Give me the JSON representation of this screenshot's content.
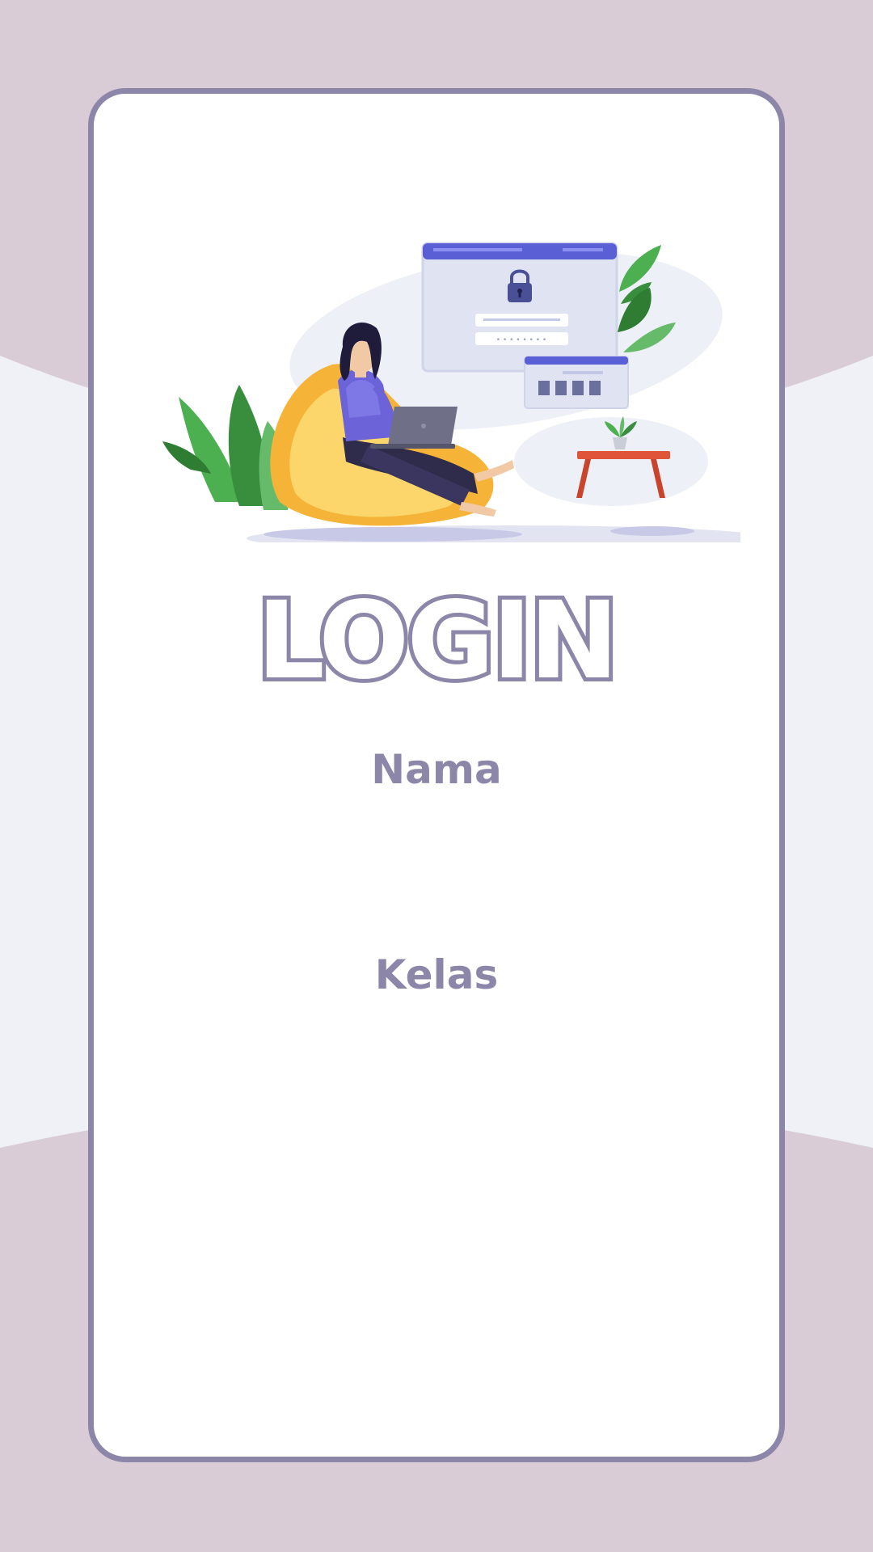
{
  "login": {
    "title": "LOGIN",
    "nama_label": "Nama",
    "nama_value": "",
    "kelas_label": "Kelas",
    "kelas_value": ""
  },
  "illustration": {
    "name": "woman-laptop-login-illustration",
    "icon": "padlock-icon"
  },
  "colors": {
    "background": "#d9ccd6",
    "background_band": "#eff1f6",
    "card": "#ffffff",
    "accent": "#8c86a8",
    "illustration_blue": "#5b5fd6",
    "beanbag": "#f5b338",
    "plant": "#4caf50",
    "table": "#e0553a"
  }
}
